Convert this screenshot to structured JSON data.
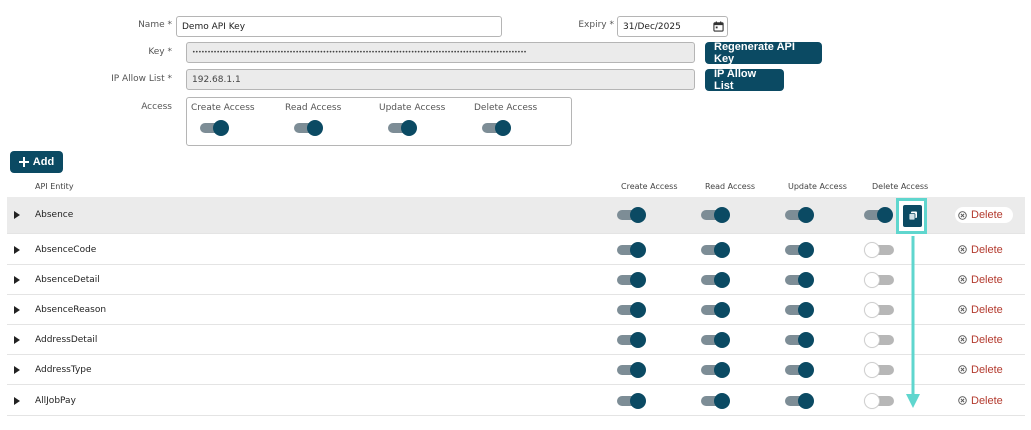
{
  "form": {
    "name_label": "Name *",
    "name_value": "Demo API Key",
    "expiry_label": "Expiry *",
    "expiry_value": "31/Dec/2025",
    "key_label": "Key *",
    "key_value": "••••••••••••••••••••••••••••••••••••••••••••••••••••••••••••••••••••••••••••••••••••••••••••••••••••••••••••••",
    "regenerate_label": "Regenerate API Key",
    "ip_label": "IP Allow List *",
    "ip_value": "192.68.1.1",
    "ip_button_label": "IP Allow List",
    "access_label": "Access",
    "access_options": [
      {
        "label": "Create Access",
        "on": true
      },
      {
        "label": "Read Access",
        "on": true
      },
      {
        "label": "Update Access",
        "on": true
      },
      {
        "label": "Delete Access",
        "on": true
      }
    ]
  },
  "toolbar": {
    "add_label": "Add"
  },
  "table": {
    "headers": {
      "entity": "API Entity",
      "create": "Create Access",
      "read": "Read Access",
      "update": "Update Access",
      "delete": "Delete Access"
    },
    "delete_label": "Delete",
    "rows": [
      {
        "name": "Absence",
        "create": true,
        "read": true,
        "update": true,
        "delete": true
      },
      {
        "name": "AbsenceCode",
        "create": true,
        "read": true,
        "update": true,
        "delete": false
      },
      {
        "name": "AbsenceDetail",
        "create": true,
        "read": true,
        "update": true,
        "delete": false
      },
      {
        "name": "AbsenceReason",
        "create": true,
        "read": true,
        "update": true,
        "delete": false
      },
      {
        "name": "AddressDetail",
        "create": true,
        "read": true,
        "update": true,
        "delete": false
      },
      {
        "name": "AddressType",
        "create": true,
        "read": true,
        "update": true,
        "delete": false
      },
      {
        "name": "AllJobPay",
        "create": true,
        "read": true,
        "update": true,
        "delete": false
      }
    ]
  },
  "colors": {
    "primary": "#0b4a63",
    "delete_text": "#b33a2e",
    "highlight": "#5fd6ce",
    "row_highlight": "#ebebeb"
  },
  "icons": {
    "add": "plus-icon",
    "calendar": "calendar-icon",
    "expand": "caret-right-icon",
    "delete": "circle-x-icon",
    "copy": "copy-icon",
    "annotation": "arrow-down-icon"
  }
}
